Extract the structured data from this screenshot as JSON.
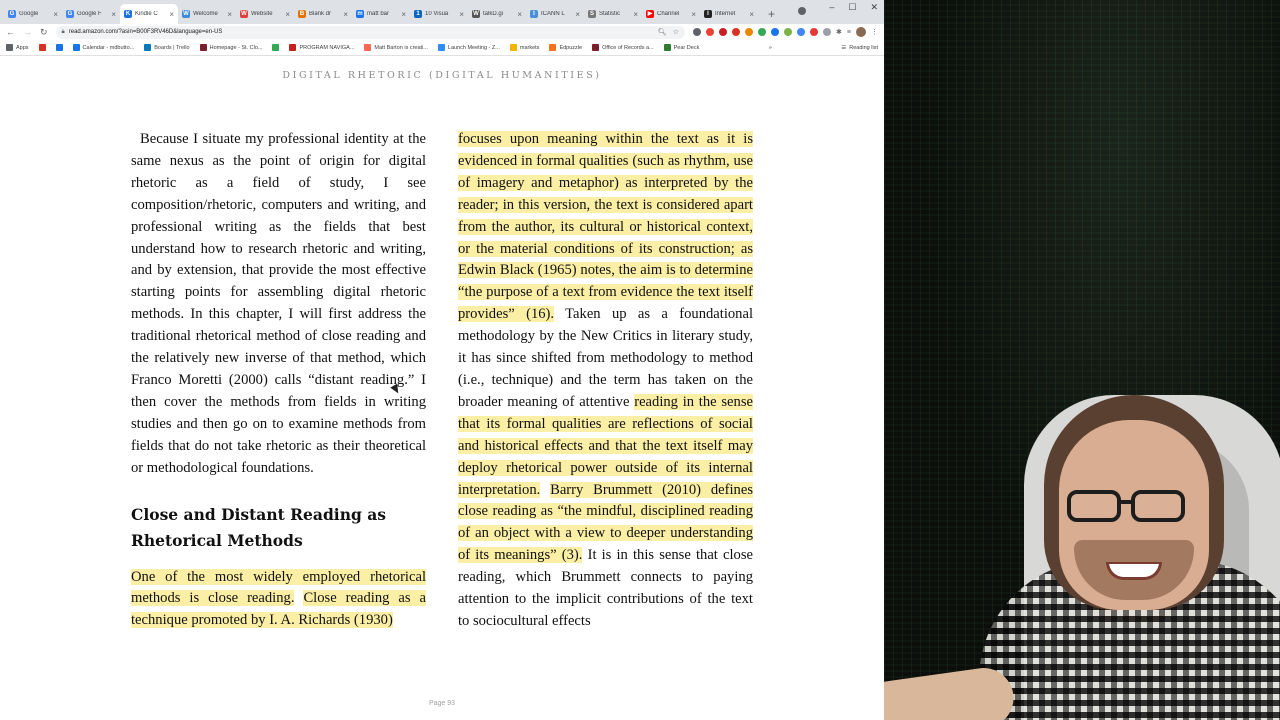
{
  "tabs": [
    {
      "label": "Google",
      "color": "#4285f4",
      "glyph": "G"
    },
    {
      "label": "Google F",
      "color": "#4285f4",
      "glyph": "G"
    },
    {
      "label": "Kindle C",
      "color": "#1a73e8",
      "glyph": "K",
      "active": true
    },
    {
      "label": "Welcome",
      "color": "#3c8bd9",
      "glyph": "W"
    },
    {
      "label": "Website",
      "color": "#e04040",
      "glyph": "W"
    },
    {
      "label": "Blank dr",
      "color": "#e37400",
      "glyph": "B"
    },
    {
      "label": "matt bar",
      "color": "#1a73e8",
      "glyph": "m"
    },
    {
      "label": "10 Visua",
      "color": "#0a66c2",
      "glyph": "1"
    },
    {
      "label": "talkD.gi",
      "color": "#555555",
      "glyph": "W"
    },
    {
      "label": "ICANN L",
      "color": "#4a90d9",
      "glyph": "I"
    },
    {
      "label": "Statistic",
      "color": "#777777",
      "glyph": "S"
    },
    {
      "label": "Channel",
      "color": "#ff0000",
      "glyph": "▶"
    },
    {
      "label": "Internet",
      "color": "#222222",
      "glyph": "I"
    }
  ],
  "toolbar": {
    "url": "read.amazon.com/?asin=B00F3RV46D&language=en-US"
  },
  "bookmarks": {
    "items": [
      {
        "label": "Apps",
        "color": "#5f6368"
      },
      {
        "label": "",
        "color": "#d93025"
      },
      {
        "label": "",
        "color": "#1a73e8"
      },
      {
        "label": "Calendar - mdbutto...",
        "color": "#1a73e8"
      },
      {
        "label": "Boards | Trello",
        "color": "#0079bf"
      },
      {
        "label": "Homepage - St. Clo...",
        "color": "#7a1f2b"
      },
      {
        "label": "",
        "color": "#34a853"
      },
      {
        "label": "PROGRAM NAVIGA...",
        "color": "#c5221f"
      },
      {
        "label": "Matt Barton is creati...",
        "color": "#f96854"
      },
      {
        "label": "Launch Meeting - Z...",
        "color": "#2d8cff"
      },
      {
        "label": "markets",
        "color": "#f4b400"
      },
      {
        "label": "Edpuzzle",
        "color": "#f37321"
      },
      {
        "label": "Office of Records a...",
        "color": "#7a1f2b"
      },
      {
        "label": "Pear Deck",
        "color": "#2e7d32"
      }
    ],
    "reading_list": "Reading list"
  },
  "reader": {
    "running_head": "DIGITAL RHETORIC (DIGITAL HUMANITIES)",
    "left_paragraph": "Because I situate my professional identity at the same nexus as the point of origin for digital rhetoric as a field of study, I see composition/rhetoric, computers and writing, and professional writing as the fields that best understand how to research rhetoric and writing, and by extension, that provide the most effective starting points for assembling digital rhetoric methods. In this chapter, I will first address the traditional rhetorical method of close reading and the relatively new inverse of that method, which Franco Moretti (2000) calls “distant reading.” I then cover the methods from fields in writing studies and then go on to examine methods from fields that do not take rhetoric as their theoretical or methodological foundations.",
    "section_heading": "Close and Distant Reading as Rhetorical Methods",
    "left_hl_1": "One of the most widely employed rhetorical methods is close reading.",
    "left_hl_2": "Close reading as a technique promoted by I. A. Richards (1930)",
    "right_hl_1": "focuses upon meaning within the text as it is evidenced in formal qualities (such as rhythm, use of imagery and metaphor) as interpreted by the reader; in this version, the text is considered apart from the author, its cultural or historical context, or the material conditions of its construction; as Edwin Black (1965) notes, the aim is to determine “the purpose of a text from evidence the text itself provides” (16).",
    "right_plain_1": "Taken up as a foundational methodology by the New Critics in literary study, it has since shifted from methodology to method (i.e., technique) and the term has taken on the broader meaning of attentive",
    "right_hl_2": "reading in the sense that its formal qualities are reflections of social and historical effects and that the text itself may deploy rhetorical power outside of its internal interpretation.",
    "right_hl_3": "Barry Brummett (2010) defines close reading as “the mindful, disciplined reading of an object with a view to deeper understanding of its meanings” (3).",
    "right_plain_2": "It is in this sense that close reading, which Brummett connects to paying attention to the implicit contributions of the text to sociocultural effects",
    "page_number": "Page 93",
    "highlight_color": "#fbefa6"
  }
}
